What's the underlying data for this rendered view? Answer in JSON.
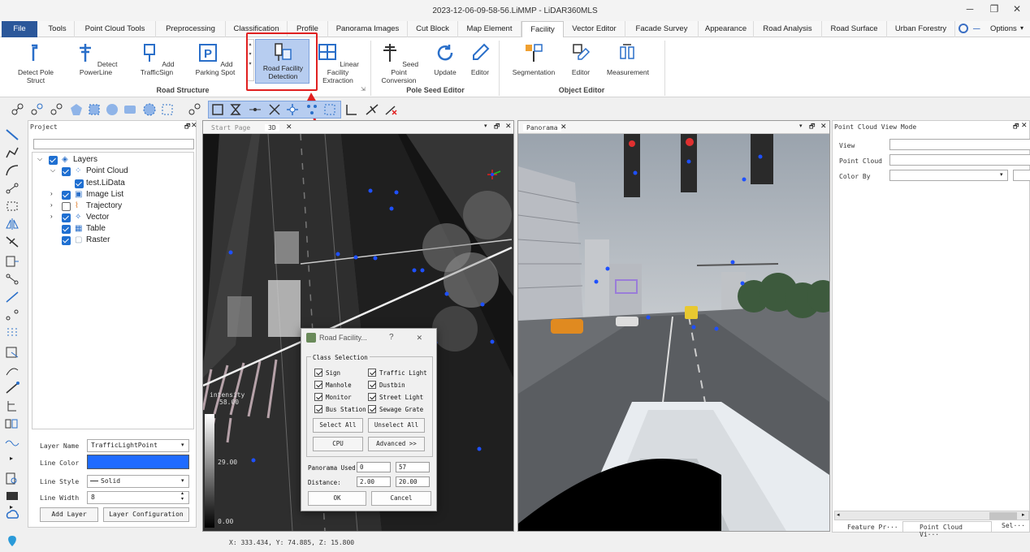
{
  "window": {
    "title": "2023-12-06-09-58-56.LiMMP - LiDAR360MLS"
  },
  "menu": {
    "file": "File",
    "tabs": [
      "Tools",
      "Point Cloud Tools",
      "Preprocessing",
      "Classification",
      "Profile",
      "Panorama Images",
      "Cut Block",
      "Map Element",
      "Facility",
      "Vector Editor",
      "Facade Survey",
      "Appearance",
      "Road Analysis",
      "Road Surface",
      "Urban Forestry"
    ],
    "options": "Options"
  },
  "ribbon": {
    "road_structure": {
      "label": "Road Structure",
      "items": [
        "Detect Pole Struct",
        "Detect PowerLine",
        "Add TrafficSign",
        "Add Parking Spot",
        "Road Facility Detection",
        "Linear Facility Extraction"
      ]
    },
    "pole_seed_editor": {
      "label": "Pole Seed Editor",
      "items": [
        "Seed Point Conversion",
        "Update",
        "Editor"
      ]
    },
    "object_editor": {
      "label": "Object Editor",
      "items": [
        "Segmentation",
        "Editor",
        "Measurement"
      ]
    }
  },
  "project": {
    "title": "Project",
    "layers": [
      {
        "label": "Layers",
        "checked": true
      },
      {
        "label": "Point Cloud",
        "checked": true
      },
      {
        "label": "test.LiData",
        "checked": true
      },
      {
        "label": "Image List",
        "checked": true
      },
      {
        "label": "Trajectory",
        "checked": false
      },
      {
        "label": "Vector",
        "checked": true
      },
      {
        "label": "Table",
        "checked": true
      },
      {
        "label": "Raster",
        "checked": true
      }
    ],
    "props": {
      "layer_name_label": "Layer Name",
      "layer_name": "TrafficLightPoint",
      "line_color_label": "Line Color",
      "line_style_label": "Line Style",
      "line_style": "Solid",
      "line_width_label": "Line Width",
      "line_width": "8",
      "add_layer": "Add Layer",
      "layer_config": "Layer Configuration"
    }
  },
  "view3d": {
    "tabs": [
      "Start Page",
      "3D"
    ],
    "intensity": {
      "title": "intensity",
      "max": "58.00",
      "mid": "29.00",
      "min": "0.00"
    }
  },
  "panorama": {
    "tab": "Panorama"
  },
  "right_panel": {
    "title": "Point Cloud View Mode",
    "fields": [
      "View",
      "Point Cloud",
      "Color By"
    ],
    "bottom_tabs": [
      "Feature Pr···",
      "Point Cloud Vi···",
      "Sel···"
    ]
  },
  "dialog": {
    "title": "Road Facility...",
    "group": "Class Selection",
    "classes": [
      "Sign",
      "Traffic Light",
      "Manhole",
      "Dustbin",
      "Monitor",
      "Street Light",
      "Bus Station",
      "Sewage Grate"
    ],
    "select_all": "Select All",
    "unselect_all": "Unselect All",
    "cpu": "CPU",
    "advanced": "Advanced >>",
    "panorama_used_label": "Panorama Used:",
    "panorama_from": "0",
    "panorama_to": "57",
    "distance_label": "Distance:",
    "distance_from": "2.00",
    "distance_to": "20.00",
    "ok": "OK",
    "cancel": "Cancel"
  },
  "status": {
    "coords": "X: 333.434, Y: 74.885, Z: 15.800"
  },
  "colors": {
    "accent": "#2b579a",
    "highlight": "#e02020",
    "selected": "#b7cdf0",
    "point": "#1e50ff"
  }
}
